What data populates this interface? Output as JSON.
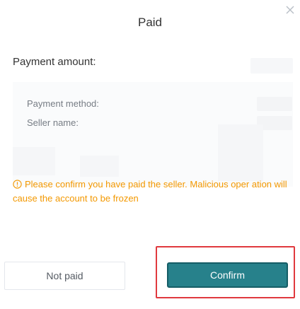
{
  "dialog": {
    "title": "Paid",
    "close_icon": "close-icon"
  },
  "payment": {
    "amount_label": "Payment amount:",
    "method_label": "Payment method:",
    "seller_label": "Seller name:"
  },
  "warning": {
    "icon": "info-circle-icon",
    "text": "Please confirm you have paid the seller. Malicious oper ation will cause the account to be frozen"
  },
  "buttons": {
    "not_paid_label": "Not paid",
    "confirm_label": "Confirm"
  },
  "colors": {
    "accent": "#27818b",
    "warning": "#f39800",
    "highlight_border": "#e0393e"
  }
}
